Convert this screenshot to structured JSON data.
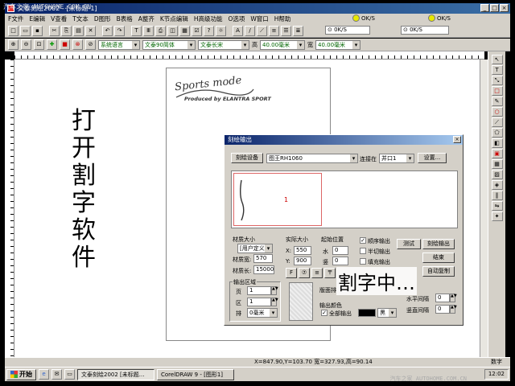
{
  "window": {
    "title": "文泰刻绘2002 - [未标题-1]",
    "watermark_top": "汽车之家 AUTOHOME.COM.CN"
  },
  "menu": [
    "F文件",
    "E编辑",
    "V查看",
    "T文本",
    "D图形",
    "B表格",
    "A整齐",
    "K节点编辑",
    "H高级功能",
    "O选项",
    "W窗口",
    "H帮助"
  ],
  "indicators": [
    {
      "label": "OK/S"
    },
    {
      "label": "OK/S"
    }
  ],
  "toolbar2": {
    "lang_combo": "系统语言",
    "font_combo": "文泰90简体",
    "style_combo": "文泰长宋",
    "height_label": "高",
    "height_value": "40.00毫米",
    "width_label": "宽",
    "width_value": "40.00毫米"
  },
  "canvas": {
    "logo_script": "Sports mode",
    "logo_sub": "Produced by ELANTRA SPORT",
    "caption_vertical": "打开割字软件"
  },
  "dialog": {
    "title": "刻绘输出",
    "device_button": "刻绘设备",
    "device_combo": "图王RH1060",
    "connect_label": "连接在",
    "port_combo": "并口1",
    "settings_button": "设置...",
    "preview_number": "1",
    "material_size_label": "材质大小",
    "material_combo": "[用户定义]",
    "material_width_label": "材质宽:",
    "material_width": "570",
    "material_length_label": "材质长:",
    "material_length": "15000",
    "actual_size_label": "实际大小",
    "actual_w_label": "X:",
    "actual_w": "550",
    "actual_h_label": "Y:",
    "actual_h": "900",
    "start_pos_label": "起始位置",
    "horiz_label": "水",
    "horiz_value": "0",
    "vert_label": "竖",
    "vert_value": "0",
    "sequential_label": "顺序输出",
    "half_cut_label": "半切输出",
    "fill_label": "填充输出",
    "test_button": "测试",
    "cut_output_button": "刻绘输出",
    "end_button": "结束",
    "auto_copy_button": "自动复制",
    "output_area_label": "输出区域",
    "page_label": "页",
    "page_value": "1",
    "area_label": "区",
    "area_value": "1",
    "row_label": "排",
    "row_value": "0毫米",
    "spacing_label": "版面排",
    "output_color_label": "输出颜色",
    "all_output_label": "全部输出",
    "color_name": "黑",
    "h_spacing_label": "水平间隔",
    "h_spacing_value": "0",
    "v_spacing_label": "竖直间隔",
    "v_spacing_value": "0",
    "align_buttons": [
      "F",
      "⑦",
      "≡",
      "〒"
    ]
  },
  "overlay_caption": "割字中…",
  "status": {
    "coords": "X=847.90,Y=103.70 宽=327.93,高=90.14",
    "mode": "数字"
  },
  "taskbar": {
    "start": "开始",
    "items": [
      "文泰刻绘2002 [未标题...",
      "CorelDRAW 9 - [图形1]"
    ],
    "clock": "12:02",
    "watermark_bottom": "汽车之家 AUTOHOME.COM.CN"
  },
  "colors": {
    "titlebar": "#0a246a",
    "chrome": "#d4d0c8",
    "accent_red": "#cc0000"
  }
}
